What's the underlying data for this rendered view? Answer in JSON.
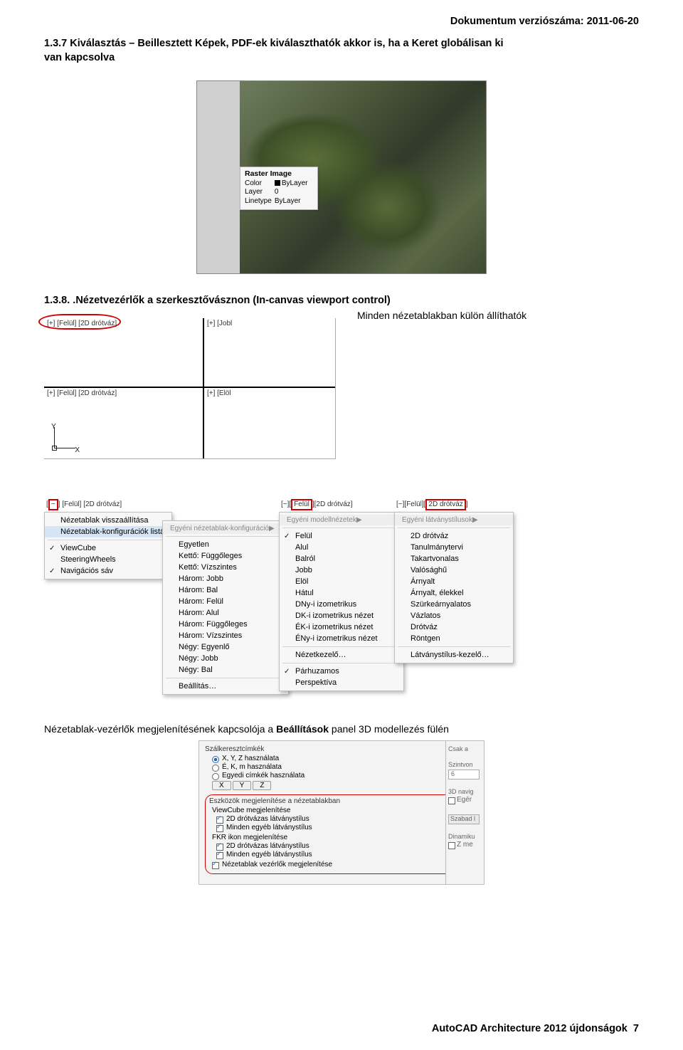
{
  "doc_header": "Dokumentum verziószáma: 2011-06-20",
  "sec137_line1": "1.3.7  Kiválasztás – Beillesztett Képek, PDF-ek kiválaszthatók akkor is, ha a Keret globálisan ki",
  "sec137_line2": "van kapcsolva",
  "raster": {
    "title": "Raster Image",
    "rows": [
      [
        "Color",
        "ByLayer"
      ],
      [
        "Layer",
        "0"
      ],
      [
        "Linetype",
        "ByLayer"
      ]
    ]
  },
  "sec138_title": "1.3.8. .Nézetvezérlők a szerkesztővásznon (In-canvas viewport control)",
  "sec138_note": "Minden nézetablakban külön állíthatók",
  "viewport_labels": {
    "tl": "[+] [Felül] [2D drótváz]",
    "tr": "[+] [Jobl",
    "bl": "[+] [Felül] [2D drótváz]",
    "br": "[+] [Elöl"
  },
  "ucs": {
    "x": "X",
    "y": "Y"
  },
  "menu_bracket_labels": {
    "a": "[−] [Felül] [2D drótváz]",
    "b": "[−] [Felül] [2D drótváz]",
    "c": "[−] [Felül][2D drótváz]"
  },
  "menu1": {
    "items": [
      "Nézetablak visszaállítása",
      "Nézetablak-konfigurációk listája",
      "ViewCube",
      "SteeringWheels",
      "Navigációs sáv"
    ],
    "checks": [
      false,
      false,
      true,
      false,
      true
    ],
    "hover_index": 1
  },
  "menu2": {
    "header": "Egyéni nézetablak-konfiguráció",
    "items": [
      "Egyetlen",
      "Kettő:  Függőleges",
      "Kettő:  Vízszintes",
      "Három: Jobb",
      "Három: Bal",
      "Három: Felül",
      "Három: Alul",
      "Három: Függőleges",
      "Három: Vízszintes",
      "Négy:  Egyenlő",
      "Négy:  Jobb",
      "Négy:  Bal",
      "Beállítás…"
    ]
  },
  "menu3": {
    "header": "Egyéni modellnézetek",
    "items": [
      "Felül",
      "Alul",
      "Balról",
      "Jobb",
      "Elöl",
      "Hátul",
      "DNy-i izometrikus",
      "DK-i izometrikus nézet",
      "ÉK-i izometrikus nézet",
      "ÉNy-i izometrikus nézet",
      "Nézetkezelő…",
      "Párhuzamos",
      "Perspektíva"
    ],
    "checks_at": [
      0,
      11
    ]
  },
  "menu4": {
    "header": "Egyéni látványstílusok",
    "items": [
      "2D drótváz",
      "Tanulmánytervi",
      "Takartvonalas",
      "Valósághű",
      "Árnyalt",
      "Árnyalt, élekkel",
      "Szürkeárnyalatos",
      "Vázlatos",
      "Drótváz",
      "Röntgen",
      "Látványstílus-kezelő…"
    ]
  },
  "ctrl_caption_a": "Nézetablak-vezérlők megjelenítésének kapcsolója a ",
  "ctrl_caption_b": "Beállítások",
  "ctrl_caption_c": " panel 3D modellezés fülén",
  "options": {
    "group_title": "Szálkeresztcímkék",
    "radios": [
      "X, Y, Z használata",
      "É, K, m használata",
      "Egyedi címkék használata"
    ],
    "xyz": [
      "X",
      "Y",
      "Z"
    ],
    "redbox_title": "Eszközök megjelenítése a nézetablakban",
    "block1_title": "ViewCube megjelenítése",
    "check1": "2D drótvázas látványstílus",
    "check2": "Minden egyéb látványstílus",
    "block2_title": "FKR ikon megjelenítése",
    "check3": "2D drótvázas látványstílus",
    "check4": "Minden egyéb látványstílus",
    "check5": "Nézetablak vezérlők megjelenítése",
    "right": {
      "a": "Csak a",
      "b": "Szintvon",
      "c": "6",
      "d": "3D navig",
      "e": "Egér",
      "f": "Szabad l",
      "g": "Dinamiku",
      "h": "Z me"
    }
  },
  "footer_text": "AutoCAD Architecture 2012 újdonságok",
  "page_num": "7"
}
